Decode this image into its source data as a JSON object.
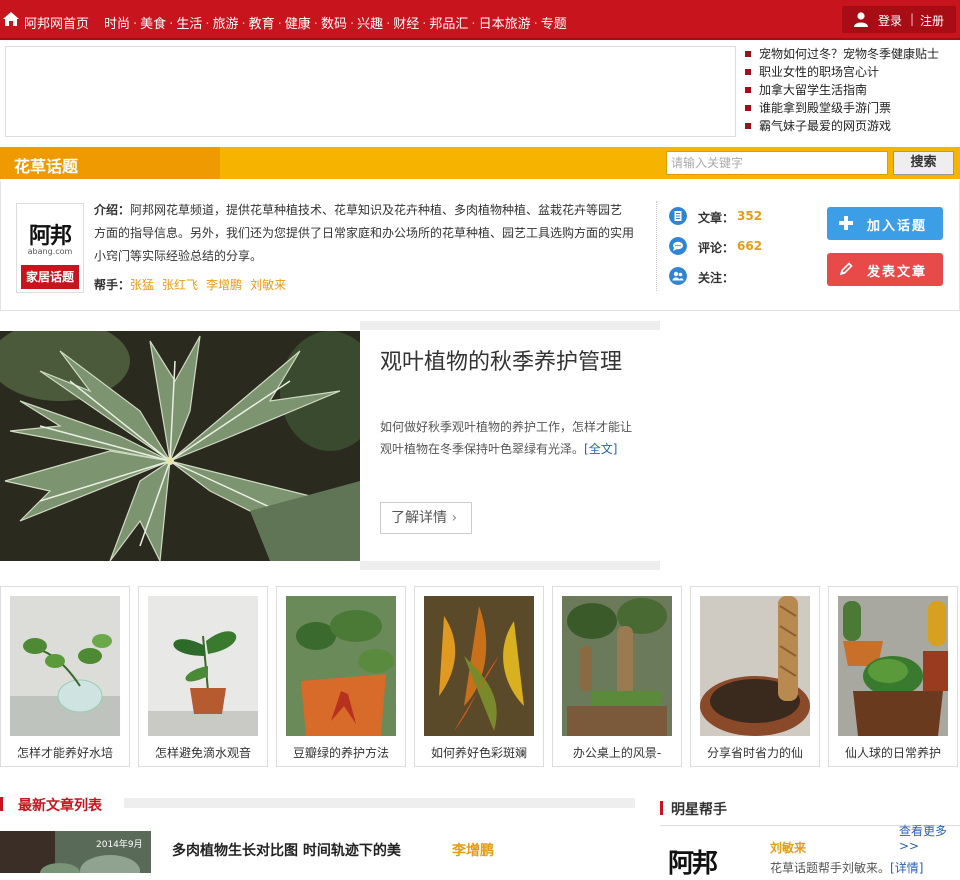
{
  "nav": {
    "home_label": "阿邦网首页",
    "items": [
      "时尚",
      "美食",
      "生活",
      "旅游",
      "教育",
      "健康",
      "数码",
      "兴趣",
      "财经",
      "邦品汇",
      "日本旅游",
      "专题"
    ],
    "login_label": "登录",
    "login_sep": "|",
    "register_label": "注册",
    "bg_color": "#c8141d"
  },
  "headlines": [
    "宠物如何过冬？宠物冬季健康贴士",
    "职业女性的职场宫心计",
    "加拿大留学生活指南",
    "谁能拿到殿堂级手游门票",
    "霸气妹子最爱的网页游戏"
  ],
  "topic": {
    "title": "花草话题",
    "search_placeholder": "请输入关键字",
    "search_button": "搜索",
    "accent_color": "#f6b400"
  },
  "intro": {
    "logo_text": "阿邦",
    "logo_domain": "abang.com",
    "logo_badge": "家居话题",
    "intro_label": "介绍：",
    "intro_body": "阿邦网花草频道，提供花草种植技术、花草知识及花卉种植、多肉植物种植、盆栽花卉等园艺方面的指导信息。另外，我们还为您提供了日常家庭和办公场所的花草种植、园艺工具选购方面的实用小窍门等实际经验总结的分享。",
    "helpers_label": "帮手：",
    "helpers": [
      "张猛",
      "张红飞",
      "李增鹏",
      "刘敏来"
    ],
    "stats": {
      "articles_label": "文章：",
      "articles_value": "352",
      "comments_label": "评论：",
      "comments_value": "662",
      "follow_label": "关注：",
      "follow_value": ""
    },
    "join_button": "加入话题",
    "post_button": "发表文章"
  },
  "feature": {
    "title": "观叶植物的秋季养护管理",
    "desc": "如何做好秋季观叶植物的养护工作，怎样才能让观叶植物在冬季保持叶色翠绿有光泽。",
    "full_link": "[全文]",
    "more_button": "了解详情"
  },
  "thumbs": [
    {
      "caption": "怎样才能养好水培"
    },
    {
      "caption": "怎样避免滴水观音"
    },
    {
      "caption": "豆瓣绿的养护方法"
    },
    {
      "caption": "如何养好色彩斑斓"
    },
    {
      "caption": "办公桌上的风景-"
    },
    {
      "caption": "分享省时省力的仙"
    },
    {
      "caption": "仙人球的日常养护"
    }
  ],
  "latest": {
    "section_title": "最新文章列表",
    "article_date": "2014年9月",
    "article_title": "多肉植物生长对比图 时间轨迹下的美",
    "article_author": "李增鹏"
  },
  "star": {
    "section_title": "明星帮手",
    "more_link": "查看更多>>",
    "logo_text": "阿邦",
    "name": "刘敏来",
    "desc": "花草话题帮手刘敏来。",
    "detail_link": "[详情]"
  }
}
